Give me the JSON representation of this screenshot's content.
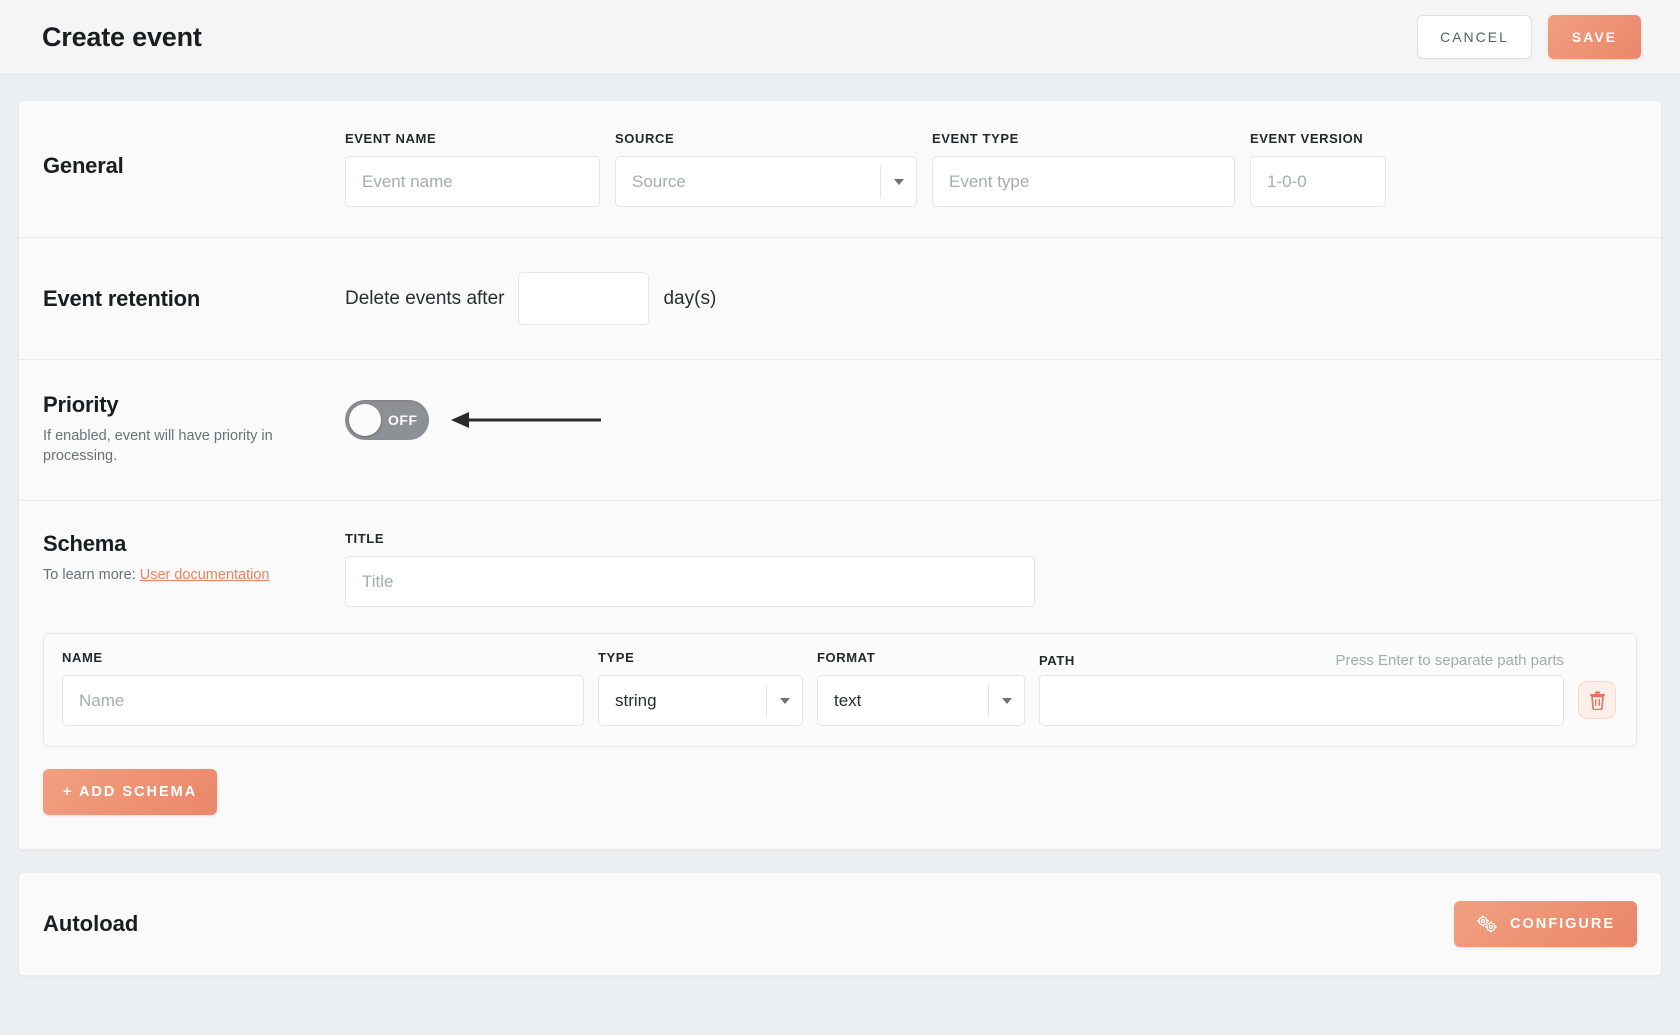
{
  "header": {
    "title": "Create event",
    "cancel_label": "CANCEL",
    "save_label": "SAVE"
  },
  "general": {
    "title": "General",
    "fields": [
      {
        "label": "EVENT NAME",
        "placeholder": "Event name",
        "value": ""
      },
      {
        "label": "SOURCE",
        "placeholder": "Source",
        "value": ""
      },
      {
        "label": "EVENT TYPE",
        "placeholder": "Event type",
        "value": ""
      },
      {
        "label": "EVENT VERSION",
        "placeholder": "1-0-0",
        "value": ""
      }
    ]
  },
  "retention": {
    "title": "Event retention",
    "prefix_text": "Delete events after",
    "suffix_text": "day(s)",
    "value": "",
    "placeholder": ""
  },
  "priority": {
    "title": "Priority",
    "description": "If enabled, event will have priority in processing.",
    "toggle_state": "OFF",
    "toggle_enabled": false
  },
  "schema": {
    "title": "Schema",
    "learn_more_prefix": "To learn more: ",
    "learn_more_link": "User documentation",
    "title_label": "TITLE",
    "title_placeholder": "Title",
    "title_value": "",
    "columns": {
      "name": "NAME",
      "type": "TYPE",
      "format": "FORMAT",
      "path": "PATH"
    },
    "path_hint": "Press Enter to separate path parts",
    "rows": [
      {
        "name_placeholder": "Name",
        "name_value": "",
        "type_value": "string",
        "format_value": "text",
        "path_value": "",
        "delete_icon": "trash-icon"
      }
    ],
    "add_label": "+ ADD SCHEMA"
  },
  "autoload": {
    "title": "Autoload",
    "configure_label": "CONFIGURE",
    "configure_icon": "gears-icon"
  },
  "colors": {
    "accent": "#eb8669",
    "accent_light": "#f0a080",
    "link": "#ec8263",
    "danger": "#e8705e",
    "toggle_off": "#8d9094",
    "page_bg": "#eceff1"
  }
}
